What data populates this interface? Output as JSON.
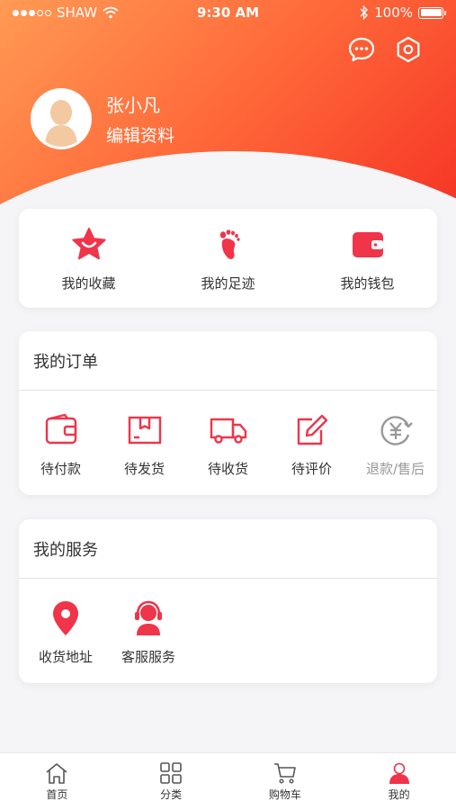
{
  "status_bar": {
    "carrier": "SHAW",
    "signal_filled": 3,
    "signal_total": 5,
    "time": "9:30 AM",
    "battery": "100%",
    "battery_level": 1.0
  },
  "header": {
    "icons": [
      "message-icon",
      "settings-icon"
    ]
  },
  "profile": {
    "name": "张小凡",
    "edit_label": "编辑资料"
  },
  "quick_links": [
    {
      "label": "我的收藏",
      "icon": "star-icon"
    },
    {
      "label": "我的足迹",
      "icon": "footprint-icon"
    },
    {
      "label": "我的钱包",
      "icon": "wallet-icon"
    }
  ],
  "orders": {
    "title": "我的订单",
    "items": [
      {
        "label": "待付款",
        "icon": "wallet-outline-icon"
      },
      {
        "label": "待发货",
        "icon": "package-icon"
      },
      {
        "label": "待收货",
        "icon": "truck-icon"
      },
      {
        "label": "待评价",
        "icon": "edit-icon"
      },
      {
        "label": "退款/售后",
        "icon": "refund-icon"
      }
    ]
  },
  "services": {
    "title": "我的服务",
    "items": [
      {
        "label": "收货地址",
        "icon": "location-pin-icon"
      },
      {
        "label": "客服服务",
        "icon": "customer-service-icon"
      }
    ]
  },
  "tabbar": [
    {
      "label": "首页",
      "icon": "home-icon"
    },
    {
      "label": "分类",
      "icon": "grid-icon"
    },
    {
      "label": "购物车",
      "icon": "cart-icon"
    },
    {
      "label": "我的",
      "icon": "user-icon",
      "active": true
    }
  ],
  "colors": {
    "accent": "#f0344a",
    "header_start": "#ff9a54",
    "header_end": "#f42c22",
    "background": "#f5f5f7",
    "muted": "#999999"
  }
}
